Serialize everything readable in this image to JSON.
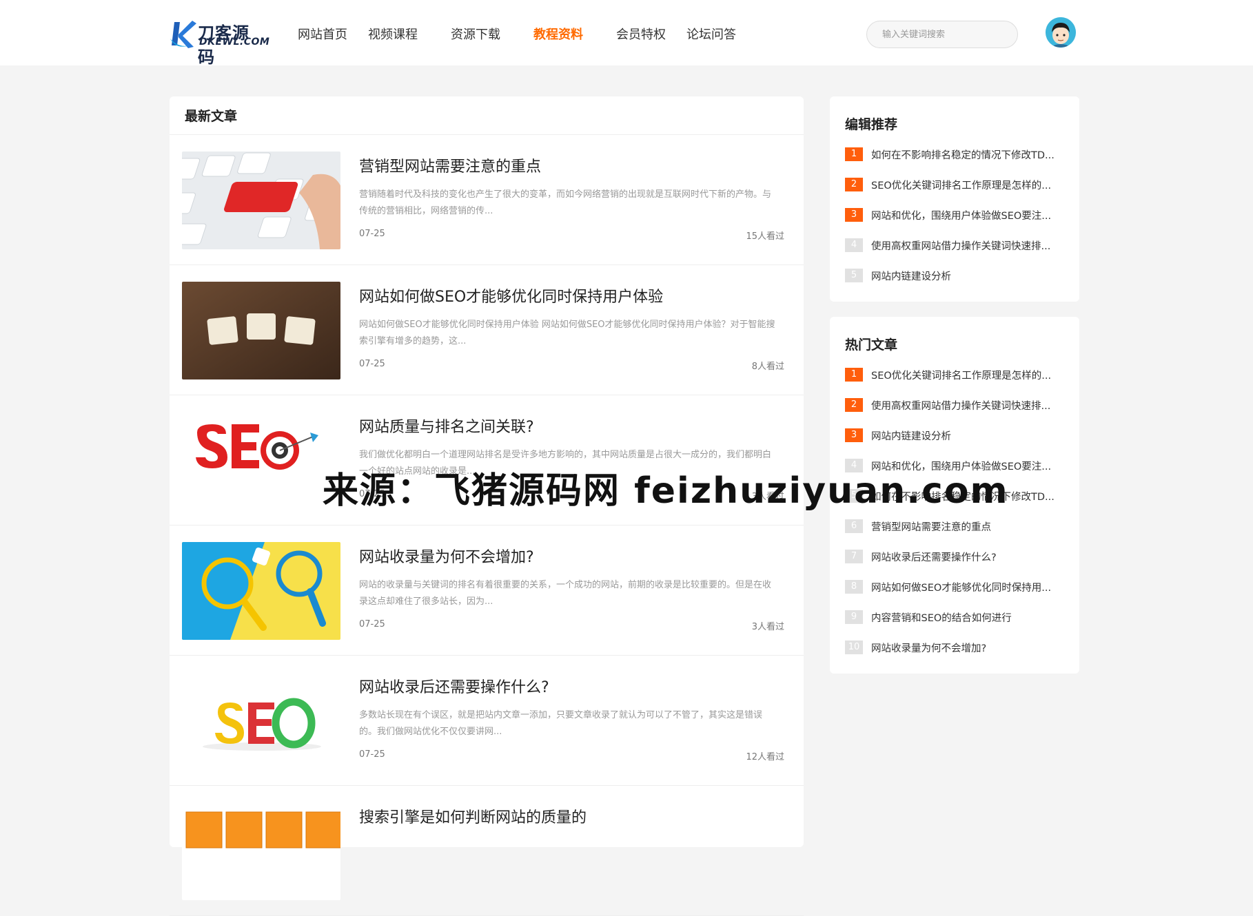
{
  "header": {
    "logo_brand": "刀客源码",
    "logo_sub": "DKEWL.COM",
    "nav": [
      {
        "label": "网站首页",
        "active": false
      },
      {
        "label": "视频课程",
        "active": false
      },
      {
        "label": "资源下载",
        "active": false
      },
      {
        "label": "教程资料",
        "active": true
      },
      {
        "label": "会员特权",
        "active": false
      },
      {
        "label": "论坛问答",
        "active": false
      }
    ],
    "search_placeholder": "输入关键词搜索",
    "accent_color": "#ff6a00"
  },
  "main": {
    "title": "最新文章",
    "articles": [
      {
        "title": "营销型网站需要注意的重点",
        "excerpt": "营销随着时代及科技的变化也产生了很大的变革，而如今网络营销的出现就是互联网时代下新的产物。与传统的营销相比，网络营销的传...",
        "date": "07-25",
        "views": "15人看过"
      },
      {
        "title": "网站如何做SEO才能够优化同时保持用户体验",
        "excerpt": "网站如何做SEO才能够优化同时保持用户体验 网站如何做SEO才能够优化同时保持用户体验？对于智能搜索引擎有增多的趋势，这...",
        "date": "07-25",
        "views": "8人看过"
      },
      {
        "title": "网站质量与排名之间关联?",
        "excerpt": "我们做优化都明白一个道理网站排名是受许多地方影响的，其中网站质量是占很大一成分的，我们都明白一个好的站点网站的收录是...",
        "date": "07-25",
        "views": "3人看过"
      },
      {
        "title": "网站收录量为何不会增加?",
        "excerpt": "网站的收录量与关键词的排名有着很重要的关系，一个成功的网站，前期的收录是比较重要的。但是在收录这点却难住了很多站长，因为...",
        "date": "07-25",
        "views": "3人看过"
      },
      {
        "title": "网站收录后还需要操作什么?",
        "excerpt": "多数站长现在有个误区，就是把站内文章一添加，只要文章收录了就认为可以了不管了，其实这是错误的。我们做网站优化不仅仅要讲网...",
        "date": "07-25",
        "views": "12人看过"
      },
      {
        "title": "搜索引擎是如何判断网站的质量的",
        "excerpt": "",
        "date": "",
        "views": ""
      }
    ]
  },
  "sidebar": {
    "editor": {
      "title": "编辑推荐",
      "items": [
        {
          "num": "1",
          "text": "如何在不影响排名稳定的情况下修改TD..."
        },
        {
          "num": "2",
          "text": "SEO优化关键词排名工作原理是怎样的..."
        },
        {
          "num": "3",
          "text": "网站和优化，围绕用户体验做SEO要注..."
        },
        {
          "num": "4",
          "text": "使用高权重网站借力操作关键词快速排..."
        },
        {
          "num": "5",
          "text": "网站内链建设分析"
        }
      ]
    },
    "hot": {
      "title": "热门文章",
      "items": [
        {
          "num": "1",
          "text": "SEO优化关键词排名工作原理是怎样的..."
        },
        {
          "num": "2",
          "text": "使用高权重网站借力操作关键词快速排..."
        },
        {
          "num": "3",
          "text": "网站内链建设分析"
        },
        {
          "num": "4",
          "text": "网站和优化，围绕用户体验做SEO要注..."
        },
        {
          "num": "5",
          "text": "如何在不影响排名稳定的情况下修改TD..."
        },
        {
          "num": "6",
          "text": "营销型网站需要注意的重点"
        },
        {
          "num": "7",
          "text": "网站收录后还需要操作什么?"
        },
        {
          "num": "8",
          "text": "网站如何做SEO才能够优化同时保持用..."
        },
        {
          "num": "9",
          "text": "内容营销和SEO的结合如何进行"
        },
        {
          "num": "10",
          "text": "网站收录量为何不会增加?"
        }
      ]
    }
  },
  "watermark": "来源：飞猪源码网 feizhuziyuan.com"
}
